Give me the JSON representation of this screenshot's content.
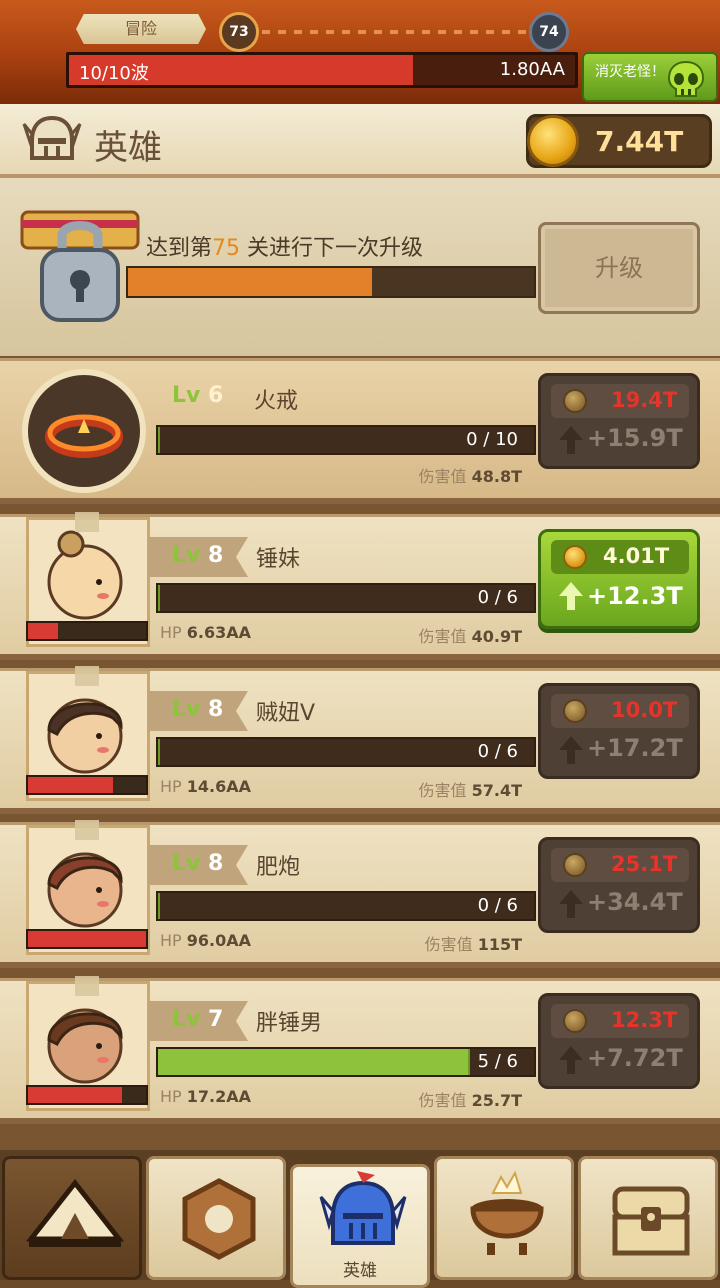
{
  "battle": {
    "tab_label": "冒险",
    "current_stage": "73",
    "next_stage": "74",
    "wave_label": "10/10波",
    "wave_fill_fraction": 0.68,
    "enemy_hp": "1.80AA",
    "boss_button_label": "消灭老怪！"
  },
  "header": {
    "title": "英雄",
    "gold": "7.44T"
  },
  "upgrade": {
    "text_prefix": "达到第",
    "level": "75",
    "text_suffix": " 关进行下一次升级",
    "progress_fraction": 0.6,
    "button_label": "升级"
  },
  "heroes": [
    {
      "lv_prefix": "Lv",
      "level": "6",
      "name": "火戒",
      "progress": "0 / 10",
      "progress_fraction": 0,
      "hp_label": "",
      "hp": "",
      "damage_label": "伤害值",
      "damage": "48.8T",
      "cost": "19.4T",
      "gain": "+15.9T",
      "affordable": false,
      "hp_fraction": 0
    },
    {
      "lv_prefix": "Lv",
      "level": "8",
      "name": "锤妹",
      "progress": "0 / 6",
      "progress_fraction": 0,
      "hp_label": "HP",
      "hp": "6.63AA",
      "damage_label": "伤害值",
      "damage": "40.9T",
      "cost": "4.01T",
      "gain": "+12.3T",
      "affordable": true,
      "hp_fraction": 0.25
    },
    {
      "lv_prefix": "Lv",
      "level": "8",
      "name": "贼妞V",
      "progress": "0 / 6",
      "progress_fraction": 0,
      "hp_label": "HP",
      "hp": "14.6AA",
      "damage_label": "伤害值",
      "damage": "57.4T",
      "cost": "10.0T",
      "gain": "+17.2T",
      "affordable": false,
      "hp_fraction": 0.72
    },
    {
      "lv_prefix": "Lv",
      "level": "8",
      "name": "肥炮",
      "progress": "0 / 6",
      "progress_fraction": 0,
      "hp_label": "HP",
      "hp": "96.0AA",
      "damage_label": "伤害值",
      "damage": "115T",
      "cost": "25.1T",
      "gain": "+34.4T",
      "affordable": false,
      "hp_fraction": 1.0
    },
    {
      "lv_prefix": "Lv",
      "level": "7",
      "name": "胖锤男",
      "progress": "5 / 6",
      "progress_fraction": 0.83,
      "hp_label": "HP",
      "hp": "17.2AA",
      "damage_label": "伤害值",
      "damage": "25.7T",
      "cost": "12.3T",
      "gain": "+7.72T",
      "affordable": false,
      "hp_fraction": 0.8
    }
  ],
  "nav": {
    "hero_label": "英雄",
    "tabs": [
      "camp-icon",
      "skill-icon",
      "hero-helmet-icon",
      "cauldron-icon",
      "chest-icon"
    ]
  },
  "colors": {
    "accent_gold": "#ffe09a",
    "cost_red": "#e8332a",
    "level_green": "#8dc53a",
    "progress_orange": "#e2812a"
  }
}
